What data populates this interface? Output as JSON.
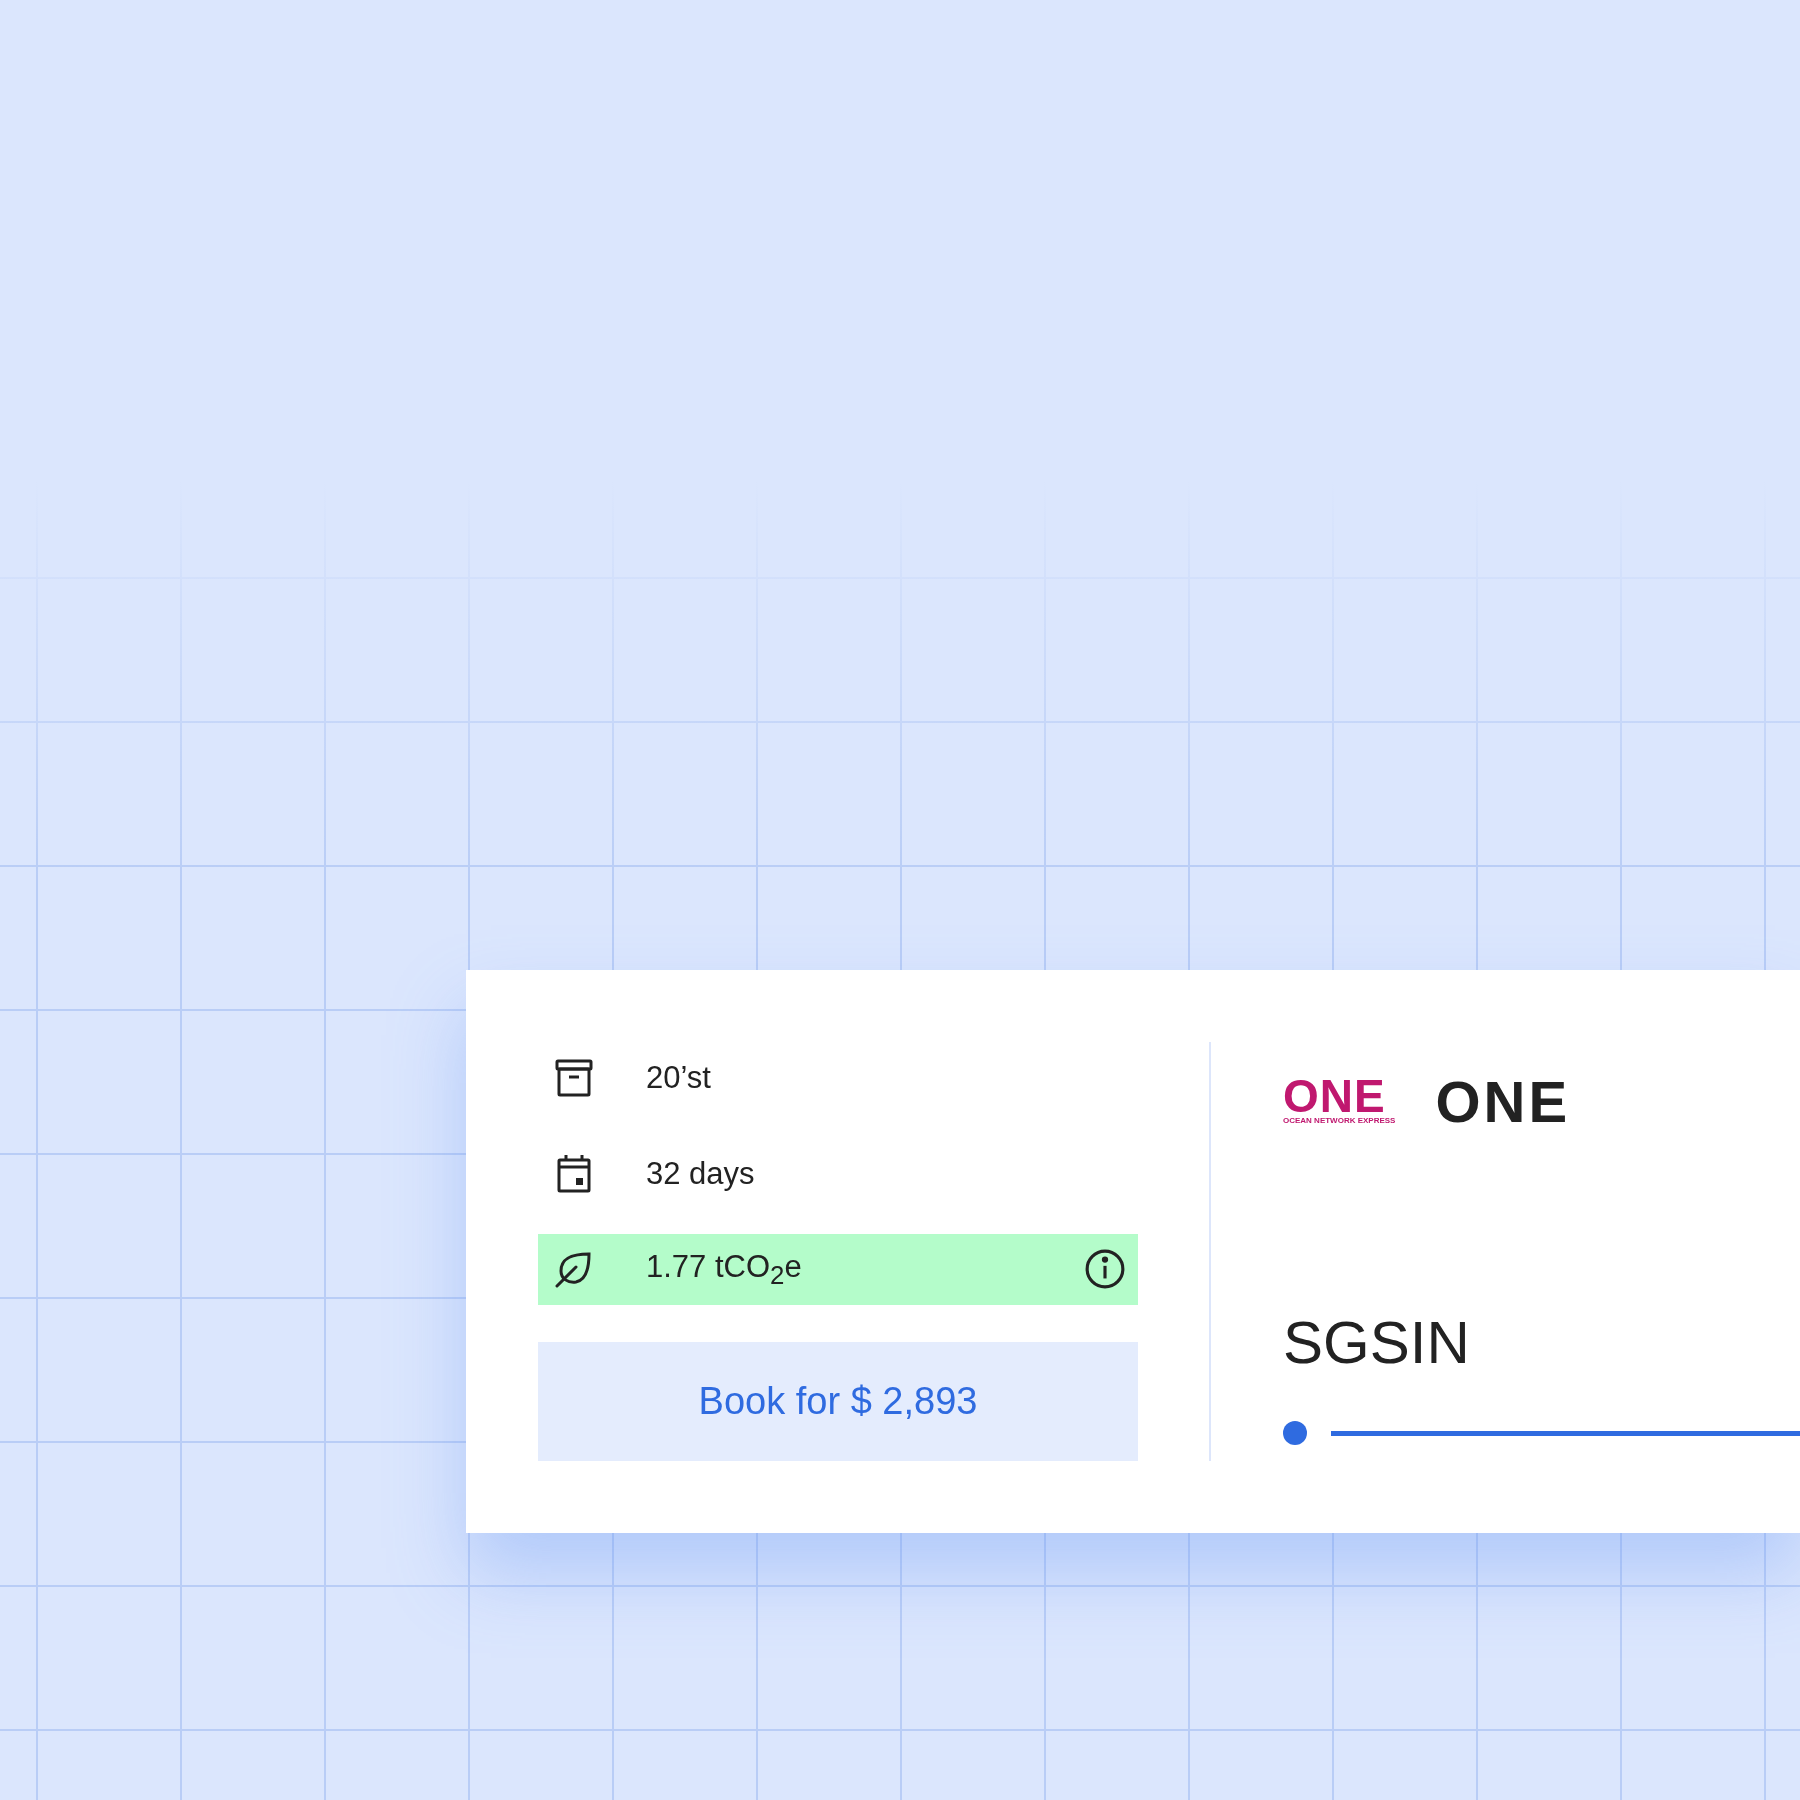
{
  "specs": [
    {
      "kind": "container",
      "text": "20’st"
    },
    {
      "kind": "duration",
      "text": "32 days"
    },
    {
      "kind": "emissions",
      "text": "1.77 tCO$_{2}$e"
    }
  ],
  "book_button": "Book for $ 2,893",
  "carrier": {
    "logo_mark": "ONE",
    "logo_tagline": "OCEAN NETWORK EXPRESS",
    "name": "ONE"
  },
  "route": {
    "origin": "SGSIN"
  }
}
